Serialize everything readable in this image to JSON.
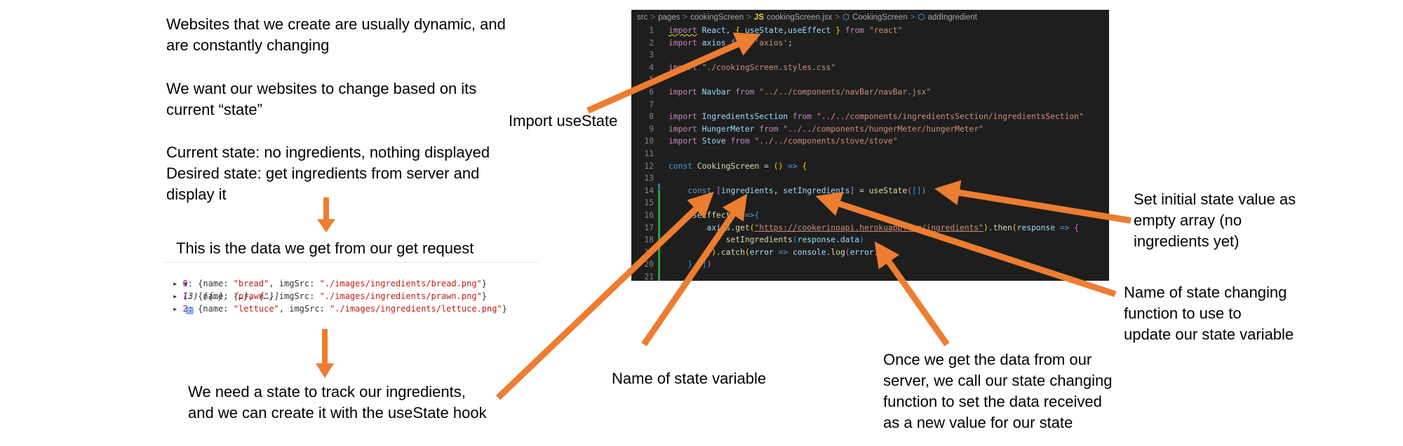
{
  "left_text": {
    "intro": "Websites that we create are usually dynamic, and\nare constantly changing",
    "want": "We want our websites to change based on its\ncurrent “state”",
    "states": "Current state: no ingredients, nothing displayed\nDesired state: get ingredients from server and\ndisplay it",
    "data_heading": "This is the data we get from our get request",
    "need_state": "We need a state to track our ingredients,\nand we can create it with the useState hook"
  },
  "console": {
    "summary": "(3) [{…}, {…}, {…}]",
    "info_icon": "i",
    "items": [
      {
        "index": "0",
        "name": "bread",
        "imgSrc": "./images/ingredients/bread.png"
      },
      {
        "index": "1",
        "name": "prawn",
        "imgSrc": "./images/ingredients/prawn.png"
      },
      {
        "index": "2",
        "name": "lettuce",
        "imgSrc": "./images/ingredients/lettuce.png"
      }
    ]
  },
  "breadcrumb": {
    "parts": [
      "src",
      "pages",
      "cookingScreen"
    ],
    "file_badge": "JS",
    "file": "cookingScreen.jsx",
    "component": "CookingScreen",
    "function": "addIngredient"
  },
  "code": {
    "line_numbers": [
      "1",
      "2",
      "3",
      "4",
      "5",
      "6",
      "7",
      "8",
      "9",
      "10",
      "11",
      "12",
      "13",
      "14",
      "15",
      "16",
      "17",
      "18",
      "19",
      "20",
      "21"
    ]
  },
  "annotations": {
    "import_usestate": "Import useState",
    "initial_value": "Set initial state value as\nempty array (no\ningredients yet)",
    "state_function": "Name of state changing\nfunction to use to\nupdate our state variable",
    "state_variable": "Name of state variable",
    "server_data": "Once we get the data from our\nserver, we call our state changing\nfunction to set the data received\nas a new value for our state"
  },
  "colors": {
    "arrow": "#ed7d31",
    "editor_bg": "#1e1e1e"
  }
}
